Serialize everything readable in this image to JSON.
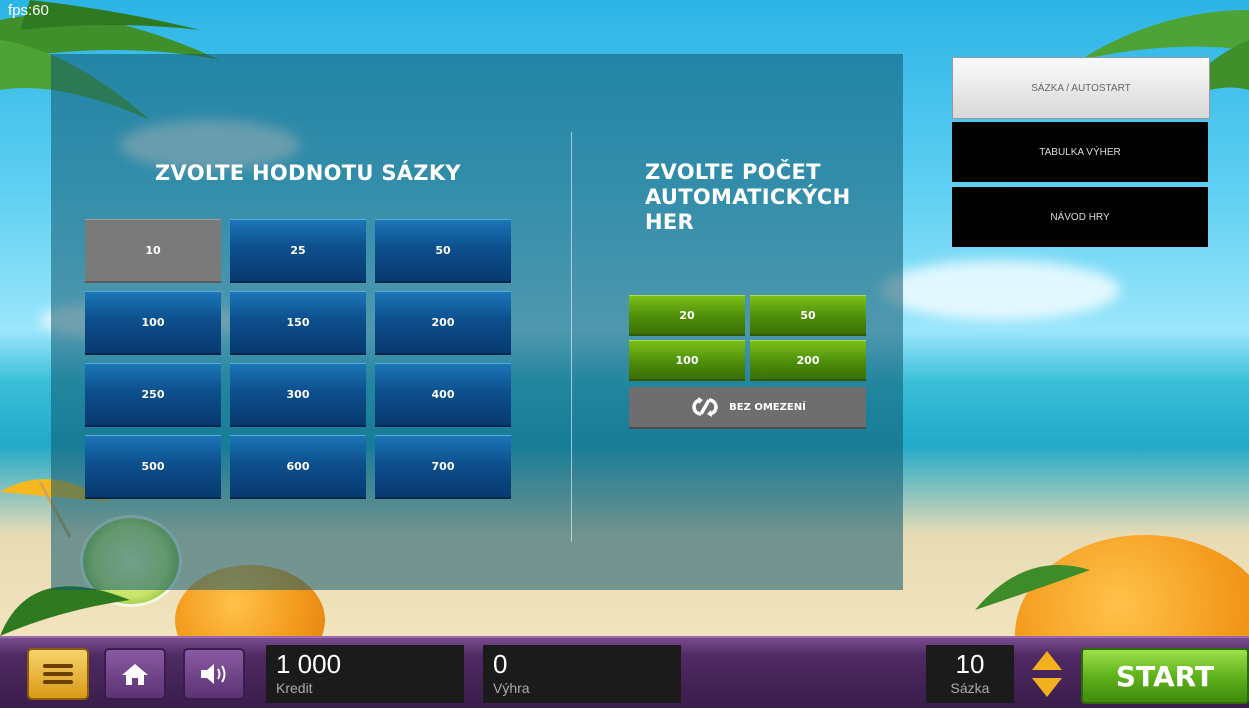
{
  "fps_label": "fps:60",
  "bet_section": {
    "heading": "ZVOLTE HODNOTU SÁZKY",
    "options": [
      "10",
      "25",
      "50",
      "100",
      "150",
      "200",
      "250",
      "300",
      "400",
      "500",
      "600",
      "700"
    ],
    "selected": "10"
  },
  "auto_section": {
    "heading": "ZVOLTE POČET AUTOMATICKÝCH HER",
    "options": [
      "20",
      "50",
      "100",
      "200"
    ],
    "unlimited_label": "BEZ OMEZENÍ"
  },
  "tabs": [
    "SÁZKA / AUTOSTART",
    "TABULKA VÝHER",
    "NÁVOD HRY"
  ],
  "active_tab": "SÁZKA / AUTOSTART",
  "bottom": {
    "credit_value": "1 000",
    "credit_label": "Kredit",
    "win_value": "0",
    "win_label": "Výhra",
    "bet_value": "10",
    "bet_label": "Sázka",
    "start_label": "START"
  },
  "icons": {
    "menu": "hamburger-icon",
    "home": "home-icon",
    "sound": "speaker-icon",
    "bet_arrows": "up-down-arrows-icon",
    "unlimited": "infinite-loop-icon"
  },
  "colors": {
    "bet_button": "#0d4f8d",
    "selected_button": "#7a7a7a",
    "auto_button": "#5fa012",
    "start_button": "#5fb21c",
    "bottom_bar": "#4f2a63"
  }
}
